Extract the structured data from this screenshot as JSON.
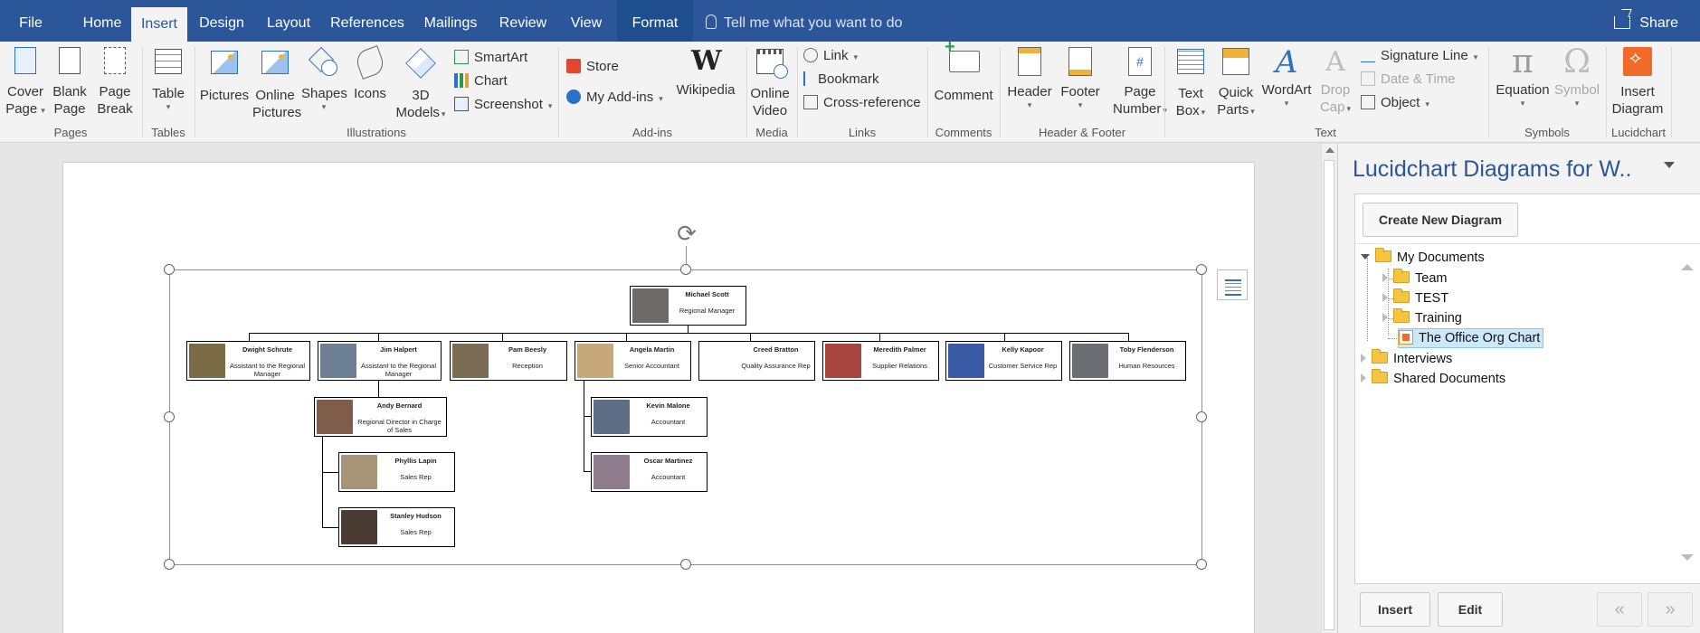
{
  "tabs": [
    "File",
    "Home",
    "Insert",
    "Design",
    "Layout",
    "References",
    "Mailings",
    "Review",
    "View",
    "Format"
  ],
  "active_tab": "Insert",
  "tell_me": "Tell me what you want to do",
  "share": "Share",
  "ribbon": {
    "pages": {
      "label": "Pages",
      "cover_page": "Cover\nPage",
      "blank_page": "Blank\nPage",
      "page_break": "Page\nBreak"
    },
    "tables": {
      "label": "Tables",
      "table": "Table"
    },
    "illustrations": {
      "label": "Illustrations",
      "pictures": "Pictures",
      "online_pictures": "Online\nPictures",
      "shapes": "Shapes",
      "icons": "Icons",
      "models_3d": "3D\nModels",
      "smartart": "SmartArt",
      "chart": "Chart",
      "screenshot": "Screenshot"
    },
    "addins": {
      "label": "Add-ins",
      "store": "Store",
      "my_addins": "My Add-ins",
      "wikipedia": "Wikipedia"
    },
    "media": {
      "label": "Media",
      "online_video": "Online\nVideo"
    },
    "links": {
      "label": "Links",
      "link": "Link",
      "bookmark": "Bookmark",
      "cross_reference": "Cross-reference"
    },
    "comments": {
      "label": "Comments",
      "comment": "Comment"
    },
    "header_footer": {
      "label": "Header & Footer",
      "header": "Header",
      "footer": "Footer",
      "page_number": "Page\nNumber"
    },
    "text": {
      "label": "Text",
      "text_box": "Text\nBox",
      "quick_parts": "Quick\nParts",
      "wordart": "WordArt",
      "drop_cap": "Drop\nCap",
      "signature_line": "Signature Line",
      "date_time": "Date & Time",
      "object": "Object"
    },
    "symbols": {
      "label": "Symbols",
      "equation": "Equation",
      "symbol": "Symbol"
    },
    "lucidchart": {
      "label": "Lucidchart",
      "insert_diagram": "Insert\nDiagram"
    }
  },
  "org_chart": {
    "root": {
      "name": "Michael Scott",
      "role": "Regional Manager",
      "photo": "#6f6a6a"
    },
    "reports": [
      {
        "name": "Dwight Schrute",
        "role": "Assistant to the Regional Manager",
        "photo": "#7a6a45"
      },
      {
        "name": "Jim Halpert",
        "role": "Assistant to the Regional Manager",
        "photo": "#6c7f93"
      },
      {
        "name": "Pam Beesly",
        "role": "Reception",
        "photo": "#7a6b55"
      },
      {
        "name": "Angela Martin",
        "role": "Senior Accountant",
        "photo": "#c7a879"
      },
      {
        "name": "Creed Bratton",
        "role": "Quality Assurance Rep",
        "photo": "#ffffff"
      },
      {
        "name": "Meredith Palmer",
        "role": "Supplier Relations",
        "photo": "#a7463f"
      },
      {
        "name": "Kelly Kapoor",
        "role": "Customer Service Rep",
        "photo": "#3b5aa6"
      },
      {
        "name": "Toby Flenderson",
        "role": "Human Resources",
        "photo": "#6b6e73"
      }
    ],
    "sub": [
      {
        "name": "Andy Bernard",
        "role": "Regional Director in Charge of Sales",
        "photo": "#7f5d4a"
      },
      {
        "name": "Phyllis Lapin",
        "role": "Sales Rep",
        "photo": "#a79375"
      },
      {
        "name": "Stanley Hudson",
        "role": "Sales Rep",
        "photo": "#4a3b33"
      },
      {
        "name": "Kevin Malone",
        "role": "Accountant",
        "photo": "#5d6e86"
      },
      {
        "name": "Oscar Martinez",
        "role": "Accountant",
        "photo": "#8e7c8c"
      }
    ]
  },
  "pane": {
    "title": "Lucidchart Diagrams for W..",
    "create_button": "Create New Diagram",
    "tree": {
      "my_documents": "My Documents",
      "team": "Team",
      "test": "TEST",
      "training": "Training",
      "office_org_chart": "The Office Org Chart",
      "interviews": "Interviews",
      "shared_documents": "Shared Documents"
    },
    "insert_button": "Insert",
    "edit_button": "Edit",
    "prev_button": "«",
    "next_button": "»"
  }
}
